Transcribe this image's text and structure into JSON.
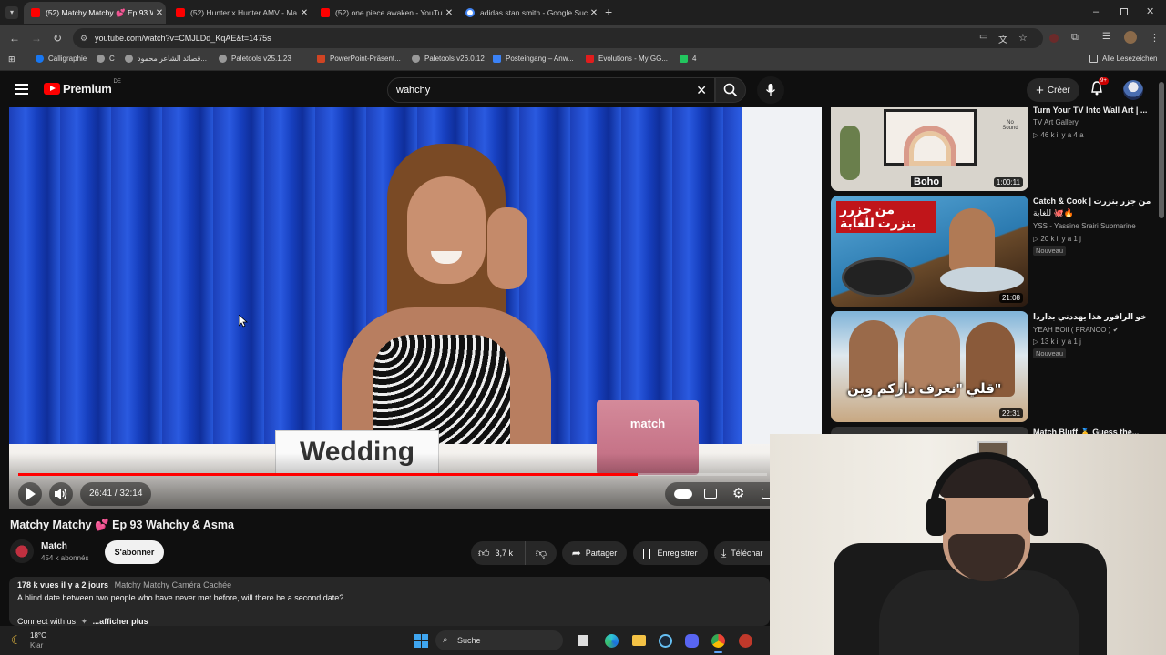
{
  "browser": {
    "tabs": [
      {
        "title": "(52) Matchy Matchy 💕 Ep 93 W",
        "favicon_color": "#ff0000",
        "active": true
      },
      {
        "title": "(52) Hunter x Hunter AMV - Ma",
        "favicon_color": "#ff0000",
        "active": false
      },
      {
        "title": "(52) one piece awaken - YouTub",
        "favicon_color": "#ff0000",
        "active": false
      },
      {
        "title": "adidas stan smith - Google Suc",
        "favicon_color": "#4285f4",
        "active": false
      }
    ],
    "new_tab": "+",
    "url": "youtube.com/watch?v=CMJLDd_KqAE&t=1475s",
    "bookmarks": [
      {
        "label": "Calligraphie",
        "color": "#1877f2"
      },
      {
        "label": "C",
        "color": "#999999"
      },
      {
        "label": "قصائد الشاعر محمود...",
        "color": "#999999"
      },
      {
        "label": "Paletools v25.1.23",
        "color": "#999999"
      },
      {
        "label": "PowerPoint-Präsent...",
        "color": "#d04423"
      },
      {
        "label": "Paletools v26.0.12",
        "color": "#999999"
      },
      {
        "label": "Posteingang – Anw...",
        "color": "#3b82f6"
      },
      {
        "label": "Evolutions - My GG...",
        "color": "#e11d1d"
      },
      {
        "label": "4",
        "color": "#22c55e"
      }
    ],
    "all_bookmarks": "Alle Lesezeichen"
  },
  "youtube": {
    "logo": "Premium",
    "region": "DE",
    "search_value": "wahchy",
    "create_label": "Créer",
    "notif_count": "9+",
    "player": {
      "caption_text": "Wedding",
      "box_text": "match",
      "time": "26:41 / 32:14",
      "progress": 0.8277
    },
    "video": {
      "title": "Matchy Matchy 💕 Ep 93 Wahchy & Asma",
      "channel": "Match",
      "subs": "454 k abonnés",
      "subscribe": "S'abonner",
      "likes": "3,7 k",
      "share": "Partager",
      "save": "Enregistrer",
      "download": "Téléchar",
      "views_date": "178 k vues  il y a 2 jours",
      "tags": "Matchy Matchy Caméra Cachée",
      "description": "A blind date between two people who have never met before, will there be a second date?",
      "connect": "Connect with us",
      "more": "...afficher plus"
    },
    "sidebar": [
      {
        "title": "Turn Your TV Into Wall Art | ...",
        "channel": "TV Art Gallery",
        "meta": "46 k  il y a 4 a",
        "duration": "1:00:11",
        "overlay": "Boho",
        "badge": "",
        "extra": "No Sound"
      },
      {
        "title": "Catch & Cook | من جزر بنزرت",
        "title2": "للغابة 🐙🔥",
        "channel": "YSS - Yassine Srairi Submarine",
        "meta": "20 k  il y a 1 j",
        "duration": "21:08",
        "overlay": "من جزرر بنزرت للغابة",
        "badge": "Nouveau"
      },
      {
        "title": "خو الرافور هذا يهددني بداردا",
        "channel": "YEAH BOiI ( FRANCO ) ✔",
        "meta": "13 k  il y a 1 j",
        "duration": "22:31",
        "overlay": "قلي \"نعرف داركم وين\"",
        "badge": "Nouveau"
      },
      {
        "title": "Match Bluff 🥇 Guess the...",
        "channel": "",
        "meta": "",
        "duration": "",
        "overlay": "",
        "badge": ""
      }
    ]
  },
  "taskbar": {
    "weather_temp": "18°C",
    "weather_desc": "Klar",
    "search": "Suche"
  }
}
